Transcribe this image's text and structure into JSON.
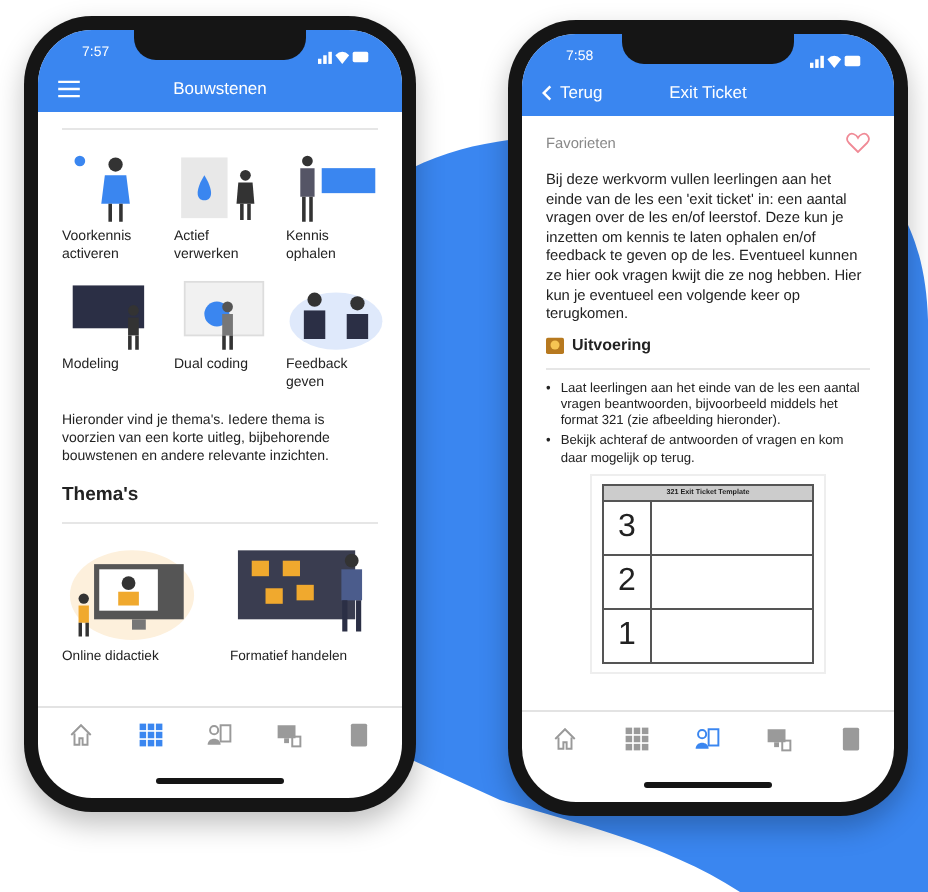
{
  "overview_screen": {
    "status_bar": {
      "time": "7:57"
    },
    "nav_bar": {
      "title": "Bouwstenen"
    },
    "blocks": [
      {
        "label": "Voorkennis activeren"
      },
      {
        "label": "Actief verwerken"
      },
      {
        "label": "Kennis ophalen"
      },
      {
        "label": "Modeling"
      },
      {
        "label": "Dual coding"
      },
      {
        "label": "Feedback geven"
      }
    ],
    "intro": "Hieronder vind je thema's. Iedere thema is voorzien van een korte uitleg, bijbehorende bouwstenen en andere relevante inzichten.",
    "section_title": "Thema's",
    "themes": [
      {
        "label": "Online didactiek"
      },
      {
        "label": "Formatief handelen"
      }
    ],
    "tab_bar": [
      {
        "selected": false
      },
      {
        "selected": true
      },
      {
        "selected": false
      },
      {
        "selected": false
      },
      {
        "selected": false
      }
    ]
  },
  "detail_screen": {
    "status_bar": {
      "time": "7:58"
    },
    "nav_bar": {
      "back": "Terug",
      "title": "Exit Ticket"
    },
    "favorites": {
      "label": "Favorieten",
      "favorited": false
    },
    "description": "Bij deze werkvorm vullen leerlingen aan het einde van de les een 'exit ticket' in: een aantal vragen over de les en/of leerstof. Deze kun je inzetten om kennis te laten ophalen en/of feedback te geven op de les. Eventueel kunnen ze hier ook vragen kwijt die ze nog hebben. Hier kun je eventueel een volgende keer op terugkomen.",
    "section_title": "Uitvoering",
    "steps": [
      {
        "marker": "•",
        "text": "Laat leerlingen aan het einde van de les een aantal vragen beantwoorden, bijvoorbeeld middels het format 321 (zie afbeelding hieronder)."
      },
      {
        "marker": "•",
        "text": "Bekijk achteraf de antwoorden of vragen en kom daar mogelijk op terug."
      }
    ],
    "template": {
      "title": "321 Exit Ticket Template",
      "rows": [
        "3",
        "2",
        "1"
      ]
    },
    "tab_bar": [
      {
        "selected": false
      },
      {
        "selected": false
      },
      {
        "selected": true
      },
      {
        "selected": false
      },
      {
        "selected": false
      }
    ]
  }
}
